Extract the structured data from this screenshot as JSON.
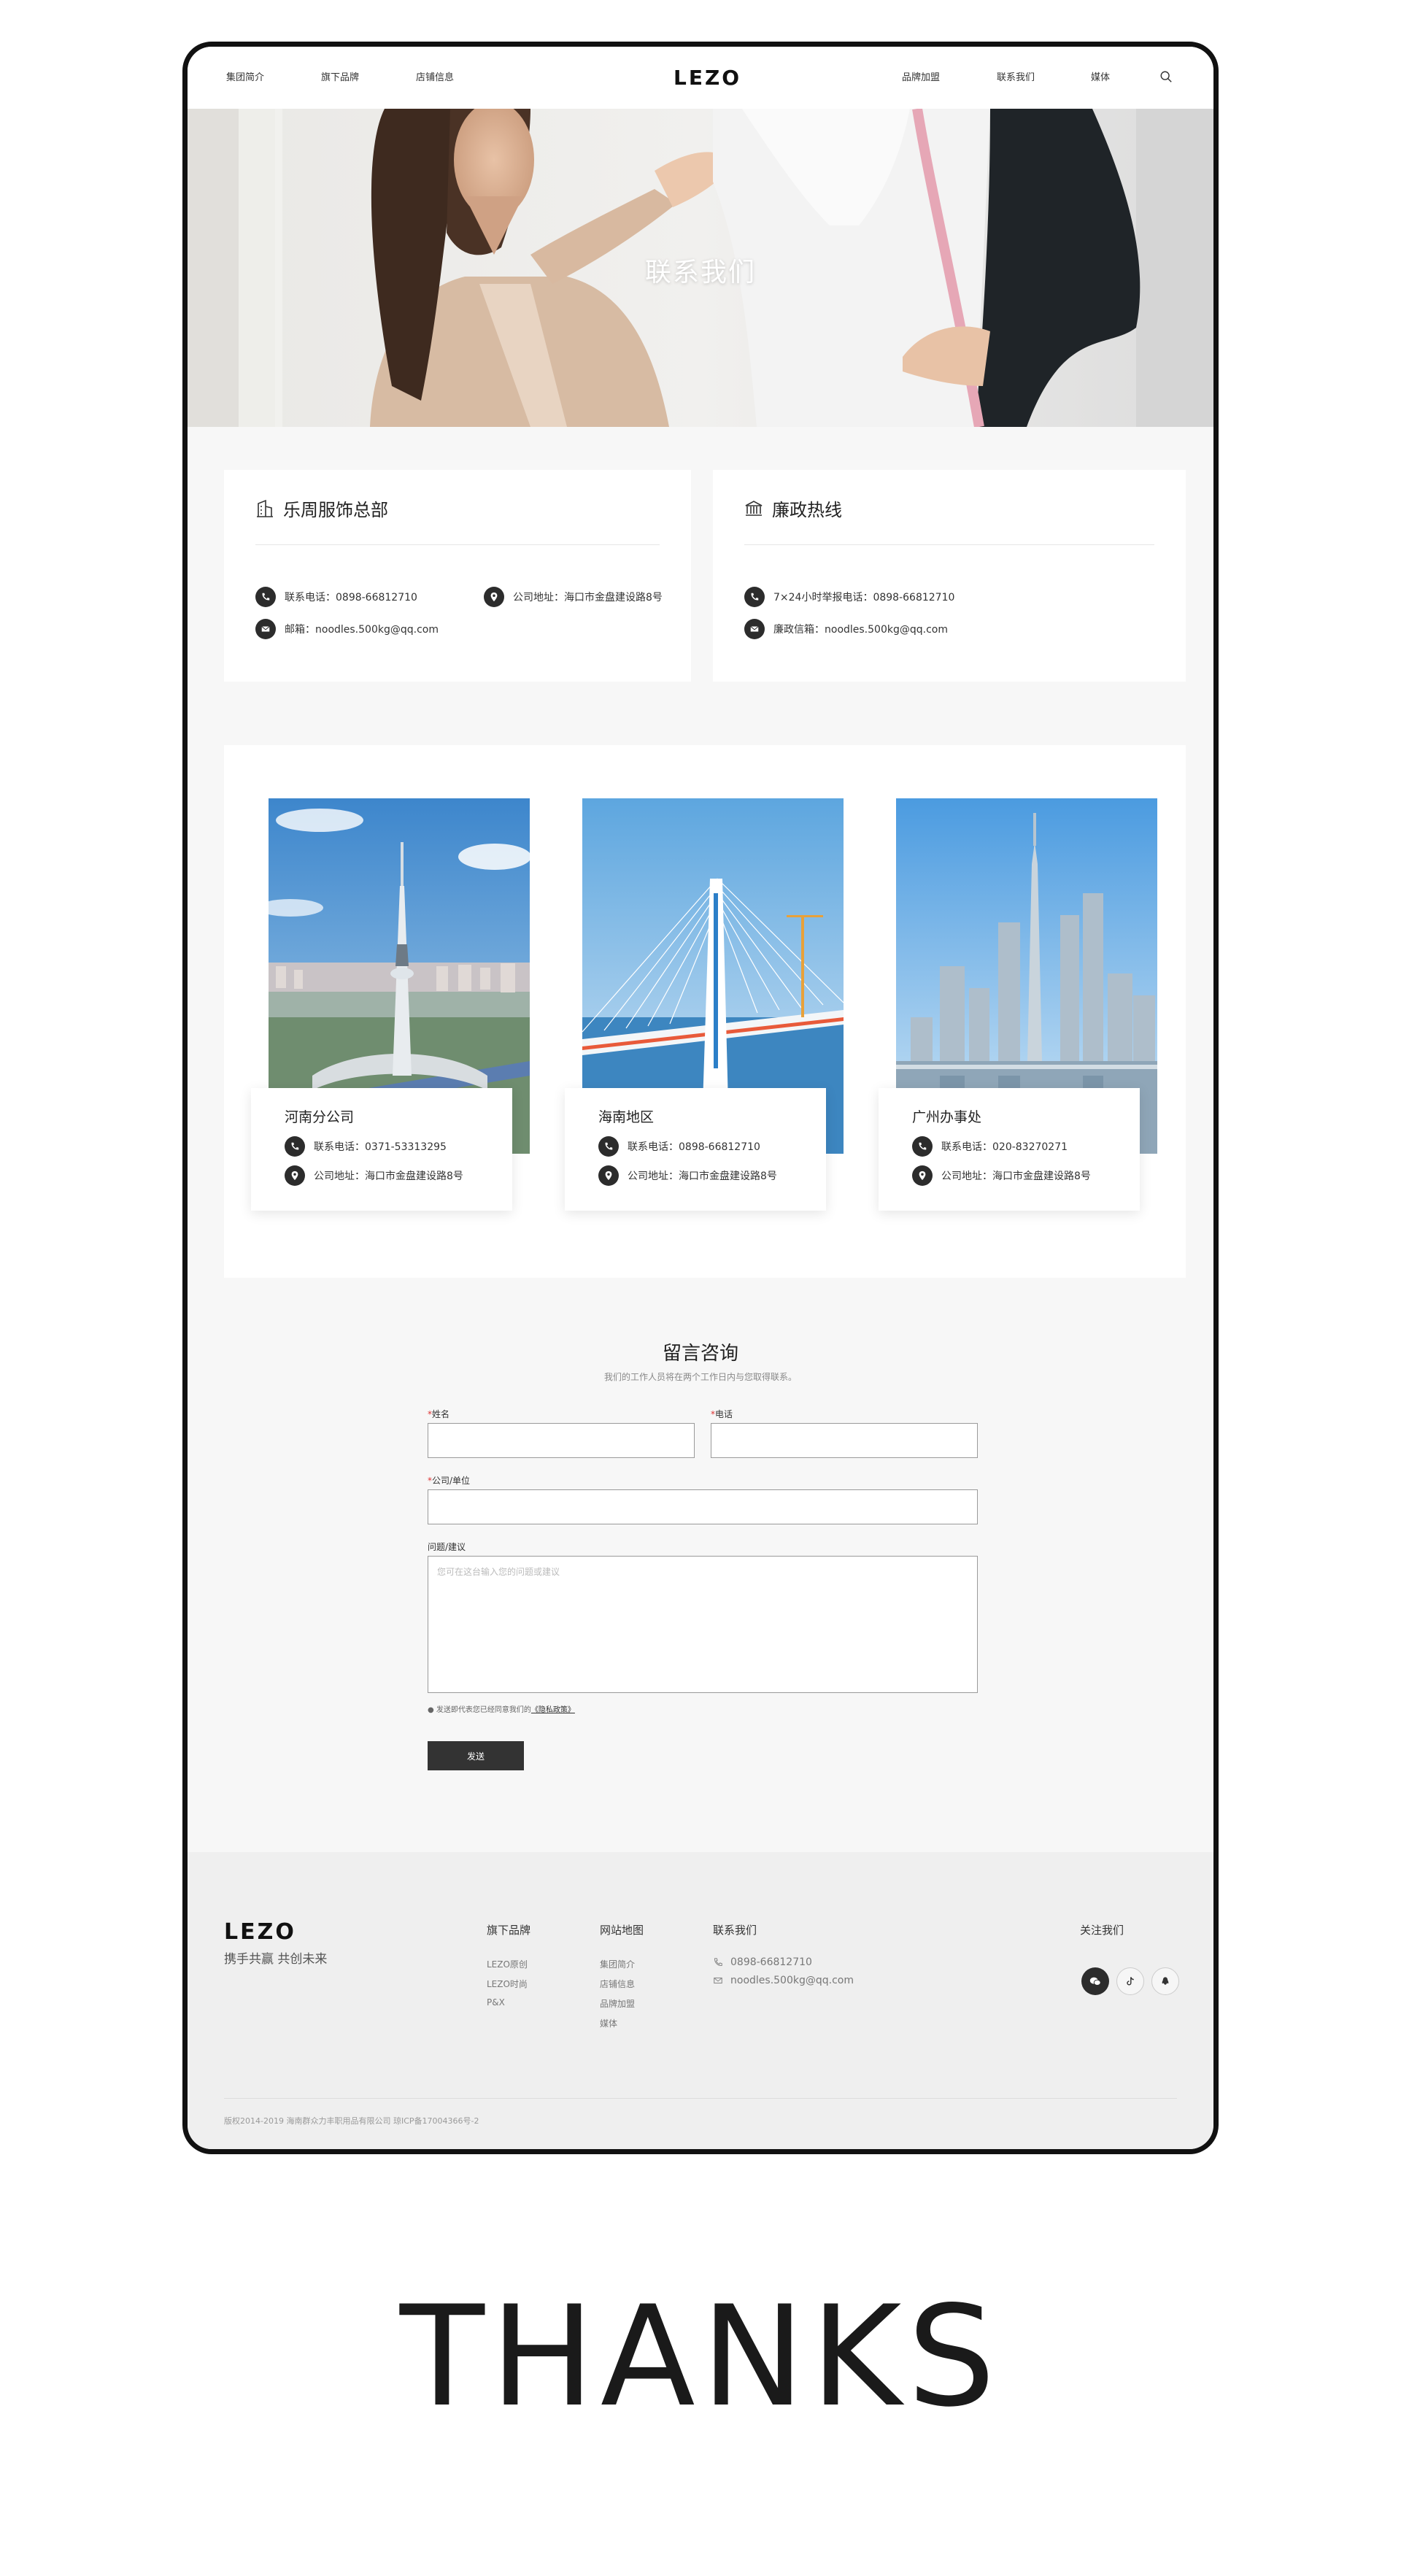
{
  "nav": {
    "left_items": [
      "集团简介",
      "旗下品牌",
      "店铺信息"
    ],
    "logo": "LEZO",
    "right_items": [
      "品牌加盟",
      "联系我们",
      "媒体"
    ],
    "active": "联系我们"
  },
  "hero": {
    "title": "联系我们"
  },
  "headquarters": {
    "title": "乐周服饰总部",
    "phone": "联系电话：0898-66812710",
    "address": "公司地址：海口市金盘建设路8号",
    "email": "邮箱：noodles.500kg@qq.com"
  },
  "hotline": {
    "title": "廉政热线",
    "phone": "7×24小时举报电话：0898-66812710",
    "email": "廉政信箱：noodles.500kg@qq.com"
  },
  "offices": [
    {
      "name": "河南分公司",
      "phone": "联系电话：0371-53313295",
      "address": "公司地址：海口市金盘建设路8号"
    },
    {
      "name": "海南地区",
      "phone": "联系电话：0898-66812710",
      "address": "公司地址：海口市金盘建设路8号"
    },
    {
      "name": "广州办事处",
      "phone": "联系电话：020-83270271",
      "address": "公司地址：海口市金盘建设路8号"
    }
  ],
  "form": {
    "title": "留言咨询",
    "subtitle": "我们的工作人员将在两个工作日内与您取得联系。",
    "name_label": "姓名",
    "phone_label": "电话",
    "company_label": "公司/单位",
    "question_label": "问题/建议",
    "question_placeholder": "您可在这台输入您的问题或建议",
    "required_mark": "*",
    "privacy_text": "发送即代表您已经同意我们的",
    "privacy_link": "《隐私政策》",
    "send_label": "发送"
  },
  "footer": {
    "logo": "LEZO",
    "slogan": "携手共赢 共创未来",
    "brands_heading": "旗下品牌",
    "brands": [
      "LEZO原创",
      "LEZO时尚",
      "P&X"
    ],
    "sitemap_heading": "网站地图",
    "sitemap": [
      "集团简介",
      "店铺信息",
      "品牌加盟",
      "媒体"
    ],
    "contact_heading": "联系我们",
    "contact_phone": "0898-66812710",
    "contact_email": "noodles.500kg@qq.com",
    "follow_heading": "关注我们",
    "social_icons": [
      "wechat-icon",
      "tiktok-icon",
      "qq-icon"
    ],
    "copyright": "版权2014-2019 海南群众力丰职用品有限公司 琼ICP备17004366号-2"
  },
  "thanks": "THANKS",
  "colors": {
    "dark": "#2c2c2c",
    "page_bg": "#f7f7f7",
    "footer_bg": "#efefef",
    "required": "#dd3333"
  }
}
